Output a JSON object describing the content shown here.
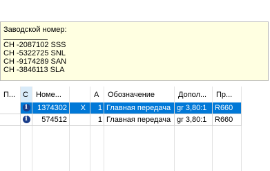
{
  "info": {
    "title": "Заводской номер:",
    "serials": [
      "CH -2087102 SSS",
      "CH -5322725 SNL",
      "CH -9174289 SAN",
      "CH -3846113 SLA"
    ]
  },
  "grid": {
    "columns": [
      {
        "label": "П..."
      },
      {
        "label": "C"
      },
      {
        "label": "Номе..."
      },
      {
        "label": ""
      },
      {
        "label": "A"
      },
      {
        "label": "Обозначение"
      },
      {
        "label": "Допол..."
      },
      {
        "label": "Пр..."
      }
    ],
    "rows": [
      {
        "selected": true,
        "icon": "info-icon",
        "number": "1374302",
        "mark": "X",
        "qty": "1",
        "designation": "Главная передача",
        "additional": "gr 3,80:1",
        "prefix": "R660"
      },
      {
        "selected": false,
        "icon": "info-icon",
        "number": "574512",
        "mark": "",
        "qty": "1",
        "designation": "Главная передача",
        "additional": "gr 3,80:1",
        "prefix": "R660"
      }
    ]
  },
  "colors": {
    "info_background": "#ffffe1",
    "selection": "#0078d7",
    "selected_column_header": "#d9ebf9",
    "info_icon": "#1a3d8a"
  }
}
